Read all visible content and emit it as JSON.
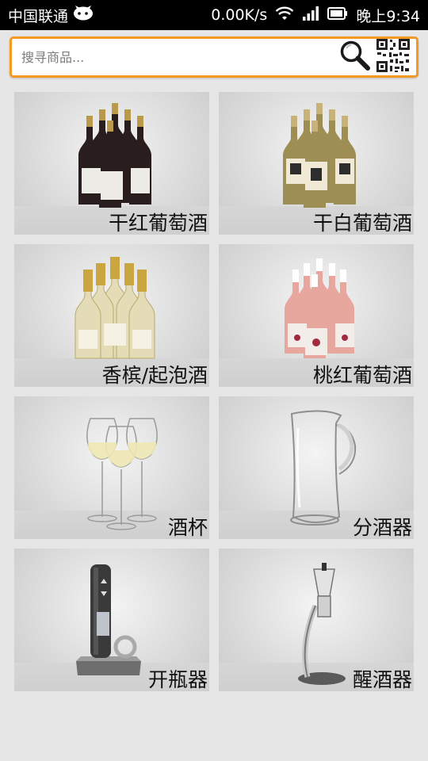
{
  "status_bar": {
    "carrier": "中国联通",
    "speed": "0.00K/s",
    "time": "晚上9:34"
  },
  "search": {
    "placeholder": "搜寻商品..."
  },
  "categories": [
    {
      "label": "干红葡萄酒",
      "icon": "red-wine-bottles"
    },
    {
      "label": "干白葡萄酒",
      "icon": "white-wine-bottles"
    },
    {
      "label": "香槟/起泡酒",
      "icon": "champagne-bottles"
    },
    {
      "label": "桃红葡萄酒",
      "icon": "rose-wine-bottles"
    },
    {
      "label": "酒杯",
      "icon": "wine-glasses"
    },
    {
      "label": "分酒器",
      "icon": "glass-pitcher"
    },
    {
      "label": "开瓶器",
      "icon": "electric-corkscrew"
    },
    {
      "label": "醒酒器",
      "icon": "wine-aerator"
    }
  ],
  "colors": {
    "search_border": "#f39a25",
    "background": "#e6e6e6",
    "status_bar": "#000000"
  }
}
